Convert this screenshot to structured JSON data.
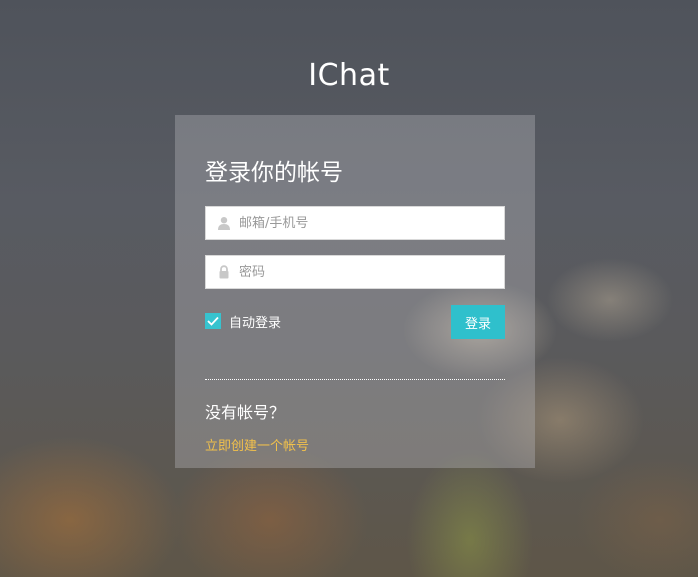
{
  "app": {
    "brand": "IChat"
  },
  "login": {
    "heading": "登录你的帐号",
    "email_placeholder": "邮箱/手机号",
    "password_placeholder": "密码",
    "remember_label": "自动登录",
    "remember_checked": true,
    "submit_label": "登录"
  },
  "signup": {
    "prompt": "没有帐号？",
    "link_label": "立即创建一个帐号"
  },
  "icons": {
    "email": "user-icon",
    "password": "lock-icon",
    "checkbox": "checkmark-icon"
  },
  "colors": {
    "accent": "#2fc0cc",
    "link": "#f2c14b"
  }
}
